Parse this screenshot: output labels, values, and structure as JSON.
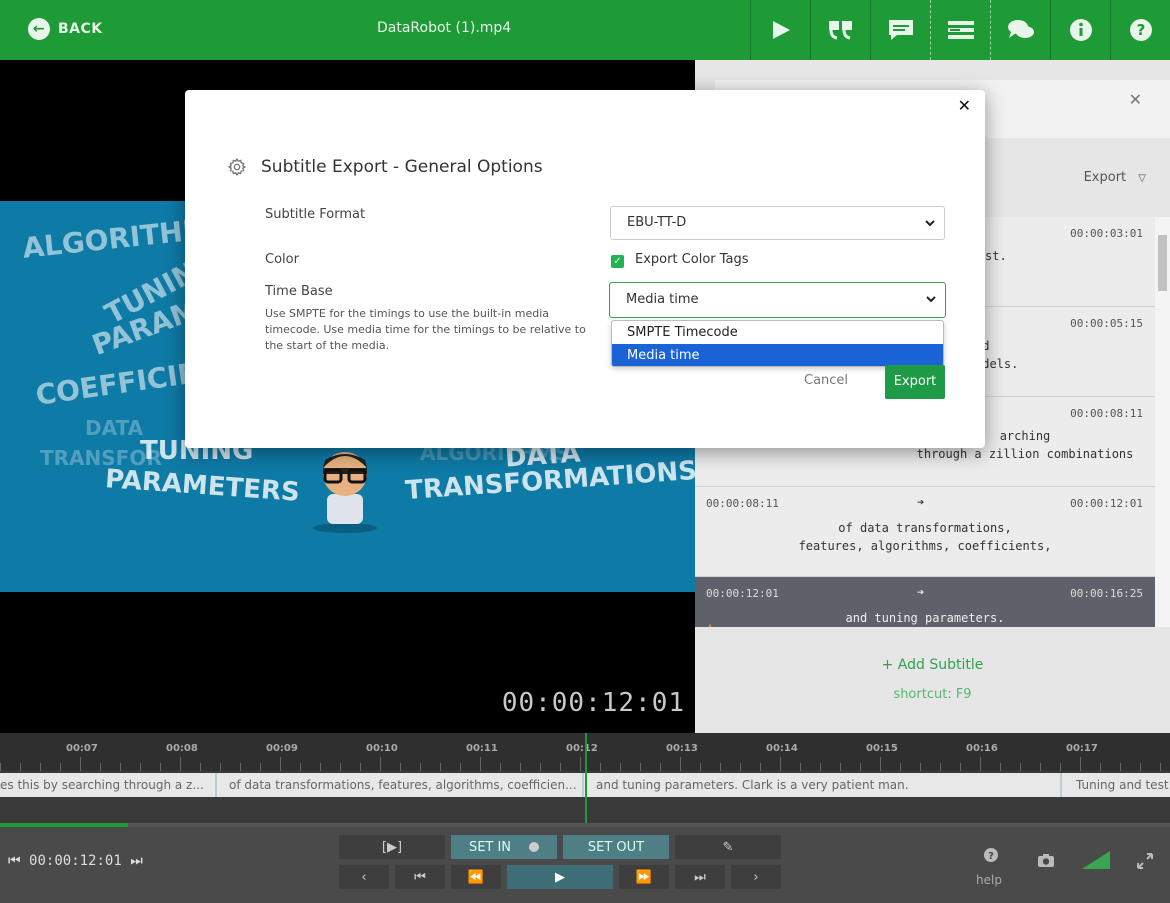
{
  "topbar": {
    "back_label": "BACK",
    "filename": "DataRobot (1).mp4",
    "icons": [
      "play-icon",
      "quote-icon",
      "caption-icon",
      "list-icon",
      "comments-icon",
      "info-icon",
      "help-icon"
    ]
  },
  "video": {
    "timecode": "00:00:12:01",
    "words": [
      "ALGORITHMS",
      "TUNING",
      "PARAM",
      "COEFFICIEN",
      "DATA",
      "TRANSFOR",
      "TUNING",
      "PARAMETERS",
      "ALGORITHMS",
      "DATA",
      "TRANSFORMATIONS"
    ]
  },
  "panel": {
    "export_label": "Export",
    "items": [
      {
        "tin": "",
        "tout": "00:00:03:01",
        "text": "st."
      },
      {
        "tin": "",
        "tout": "00:00:05:15",
        "text": "ld\nodels."
      },
      {
        "tin": "",
        "tout": "00:00:08:11",
        "text": "arching\nthrough a zillion combinations"
      },
      {
        "tin": "00:00:08:11",
        "tout": "00:00:12:01",
        "text": "of data transformations,\nfeatures, algorithms, coefficients,"
      },
      {
        "tin": "00:00:12:01",
        "tout": "00:00:16:25",
        "text": "and tuning parameters."
      }
    ],
    "add_subtitle": "+ Add Subtitle",
    "shortcut": "shortcut: F9"
  },
  "timeline": {
    "ticks": [
      "00:07",
      "00:08",
      "00:09",
      "00:10",
      "00:11",
      "00:12",
      "00:13",
      "00:14",
      "00:15",
      "00:16",
      "00:17"
    ],
    "segments": [
      "es this by searching through a z...",
      "of data transformations, features, algorithms, coefficien...",
      "and tuning parameters. Clark is a very patient man.",
      "Tuning and test"
    ]
  },
  "controls": {
    "timecode": "00:00:12:01",
    "frame_label": "[▶]",
    "set_in": "SET IN",
    "set_out": "SET OUT",
    "help": "help"
  },
  "modal": {
    "title": "Subtitle Export - General Options",
    "format_label": "Subtitle Format",
    "format_value": "EBU-TT-D",
    "color_label": "Color",
    "color_checkbox_label": "Export Color Tags",
    "time_base_label": "Time Base",
    "time_base_hint": "Use SMPTE for the timings to use the built-in media timecode. Use media time for the timings to be relative to the start of the media.",
    "time_base_value": "Media time",
    "options": [
      "SMPTE Timecode",
      "Media time"
    ],
    "selected_option": "Media time",
    "cancel_label": "Cancel",
    "export_label": "Export",
    "accent": "#1f9a47",
    "highlight": "#1a63d6"
  }
}
